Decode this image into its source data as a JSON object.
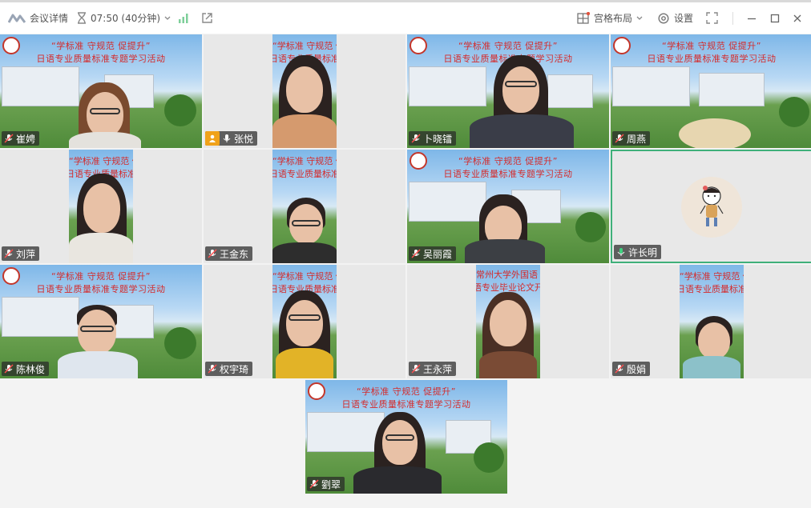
{
  "toolbar": {
    "meeting_details": "会议详情",
    "timer": "07:50 (40分钟)",
    "layout_label": "宫格布局",
    "settings_label": "设置"
  },
  "banner": {
    "line1": "“学标准 守规范 促提升”",
    "line2": "日语专业质量标准专题学习活动"
  },
  "banner_alt": {
    "line1": "常州大学外国语",
    "line2": "语专业毕业论文开"
  },
  "participants": [
    {
      "name": "崔娉",
      "mic": "muted"
    },
    {
      "name": "张悦",
      "mic": "on",
      "host": true
    },
    {
      "name": "卜晓镭",
      "mic": "muted"
    },
    {
      "name": "周燕",
      "mic": "muted"
    },
    {
      "name": "刘萍",
      "mic": "muted"
    },
    {
      "name": "王金东",
      "mic": "muted"
    },
    {
      "name": "吴丽霞",
      "mic": "muted"
    },
    {
      "name": "许长明",
      "mic": "muted",
      "speaking": true
    },
    {
      "name": "陈林俊",
      "mic": "muted"
    },
    {
      "name": "权宇琦",
      "mic": "muted"
    },
    {
      "name": "王永萍",
      "mic": "muted"
    },
    {
      "name": "殷娟",
      "mic": "muted"
    },
    {
      "name": "劉翠",
      "mic": "muted"
    }
  ],
  "colors": {
    "banner_red": "#d52a2a",
    "active_border": "#3fb07a",
    "host_badge": "#f0a21a"
  }
}
